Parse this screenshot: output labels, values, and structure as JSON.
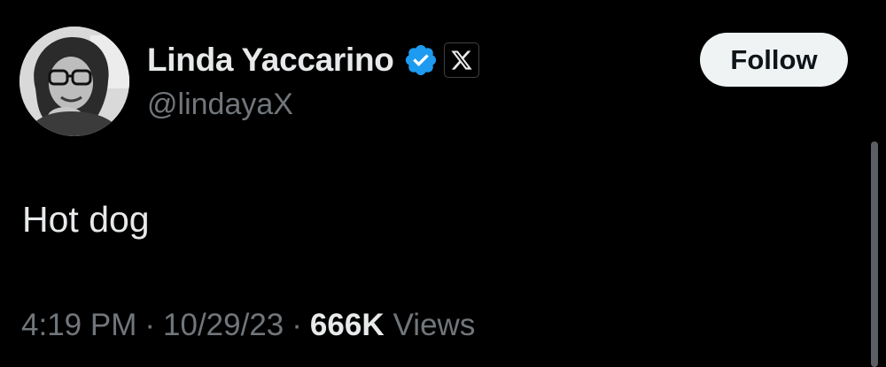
{
  "author": {
    "display_name": "Linda Yaccarino",
    "handle": "@lindayaX",
    "verified_badge_icon": "verified-check-icon",
    "verified_badge_color": "#1d9bf0",
    "affiliate_badge_icon": "x-logo-icon"
  },
  "follow_button": {
    "label": "Follow",
    "background": "#eff3f4"
  },
  "tweet": {
    "text": "Hot dog"
  },
  "meta": {
    "time": "4:19 PM",
    "separator": "·",
    "date": "10/29/23",
    "views_count": "666K",
    "views_label": "Views"
  },
  "colors": {
    "background": "#000000",
    "primary_text": "#e7e9ea",
    "secondary_text": "#71767b"
  }
}
